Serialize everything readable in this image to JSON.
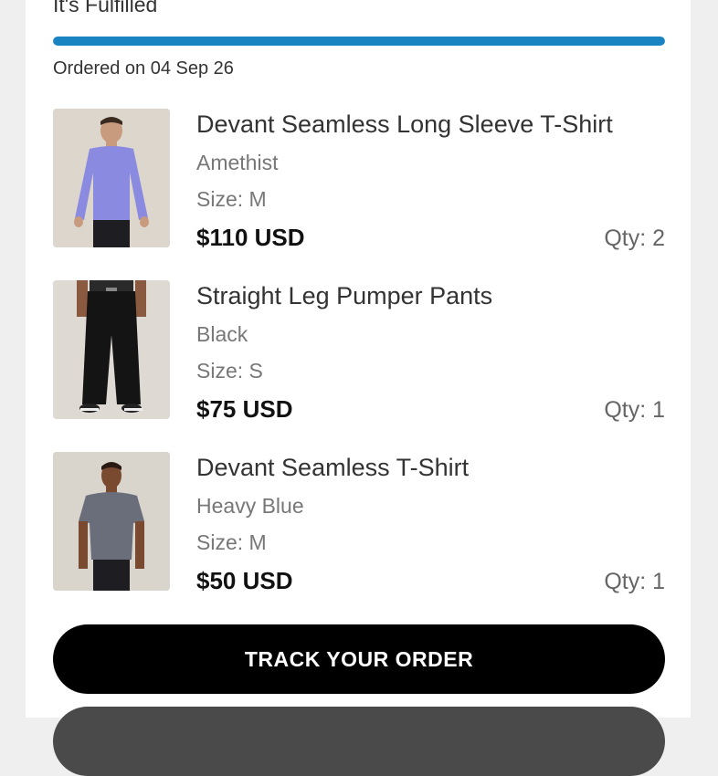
{
  "order": {
    "status": "It's Fulfilled",
    "progress_percent": 100,
    "progress_color": "#1a84c2",
    "ordered_on": "Ordered on 04 Sep 26"
  },
  "items": [
    {
      "name": "Devant Seamless Long Sleeve T-Shirt",
      "color": "Amethist",
      "size": "Size: M",
      "price": "$110 USD",
      "qty": "Qty: 2",
      "image": "model-long-sleeve-shirt-purple"
    },
    {
      "name": "Straight Leg Pumper Pants",
      "color": "Black",
      "size": "Size: S",
      "price": "$75 USD",
      "qty": "Qty: 1",
      "image": "model-black-pants"
    },
    {
      "name": "Devant Seamless T-Shirt",
      "color": "Heavy Blue",
      "size": "Size: M",
      "price": "$50 USD",
      "qty": "Qty: 1",
      "image": "model-grey-tshirt"
    }
  ],
  "actions": {
    "track_label": "TRACK YOUR ORDER"
  }
}
